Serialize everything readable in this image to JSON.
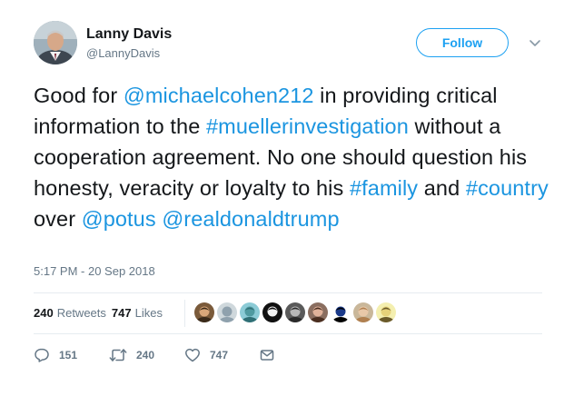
{
  "author": {
    "display_name": "Lanny Davis",
    "handle": "@LannyDavis"
  },
  "follow_label": "Follow",
  "tweet": {
    "segments": [
      {
        "text": "Good for ",
        "link": false
      },
      {
        "text": "@michaelcohen212",
        "link": true
      },
      {
        "text": " in providing critical information to the ",
        "link": false
      },
      {
        "text": "#muellerinvestigation",
        "link": true
      },
      {
        "text": " without a cooperation agreement. No one should question his honesty, veracity or loyalty to his ",
        "link": false
      },
      {
        "text": "#family",
        "link": true
      },
      {
        "text": " and ",
        "link": false
      },
      {
        "text": "#country",
        "link": true
      },
      {
        "text": " over ",
        "link": false
      },
      {
        "text": "@potus",
        "link": true
      },
      {
        "text": " ",
        "link": false
      },
      {
        "text": "@realdonaldtrump",
        "link": true
      }
    ]
  },
  "timestamp": "5:17 PM - 20 Sep 2018",
  "stats": {
    "retweets_count": "240",
    "retweets_label": "Retweets",
    "likes_count": "747",
    "likes_label": "Likes"
  },
  "liker_avatars": [
    {
      "bg": "#7a5a3a",
      "skin": "#d9a77a",
      "hair": "#3a2a1a"
    },
    {
      "bg": "#cfd8dc",
      "skin": "#8fa1ad",
      "hair": "#8fa1ad"
    },
    {
      "bg": "#8ccbd6",
      "skin": "#4f9aa0",
      "hair": "#2f6f75"
    },
    {
      "bg": "#111111",
      "skin": "#f2f2f2",
      "hair": "#111111"
    },
    {
      "bg": "#5a5a5a",
      "skin": "#b8b8b8",
      "hair": "#2a2a2a"
    },
    {
      "bg": "#8a6e60",
      "skin": "#e0b29a",
      "hair": "#4a2e20"
    },
    {
      "bg": "#ffffff",
      "skin": "#1a3a8a",
      "hair": "#000000"
    },
    {
      "bg": "#c9b79a",
      "skin": "#e8c8a8",
      "hair": "#b08050"
    },
    {
      "bg": "#f4efb0",
      "skin": "#e6d27a",
      "hair": "#6a5a2a"
    }
  ],
  "actions": {
    "reply_count": "151",
    "retweet_count": "240",
    "like_count": "747"
  },
  "colors": {
    "link": "#1b95e0",
    "follow": "#1da1f2",
    "muted": "#657786",
    "text": "#14171a",
    "divider": "#e6ecf0"
  },
  "icons": {
    "more": "chevron-down-icon",
    "reply": "reply-icon",
    "retweet": "retweet-icon",
    "like": "heart-icon",
    "message": "envelope-icon"
  }
}
